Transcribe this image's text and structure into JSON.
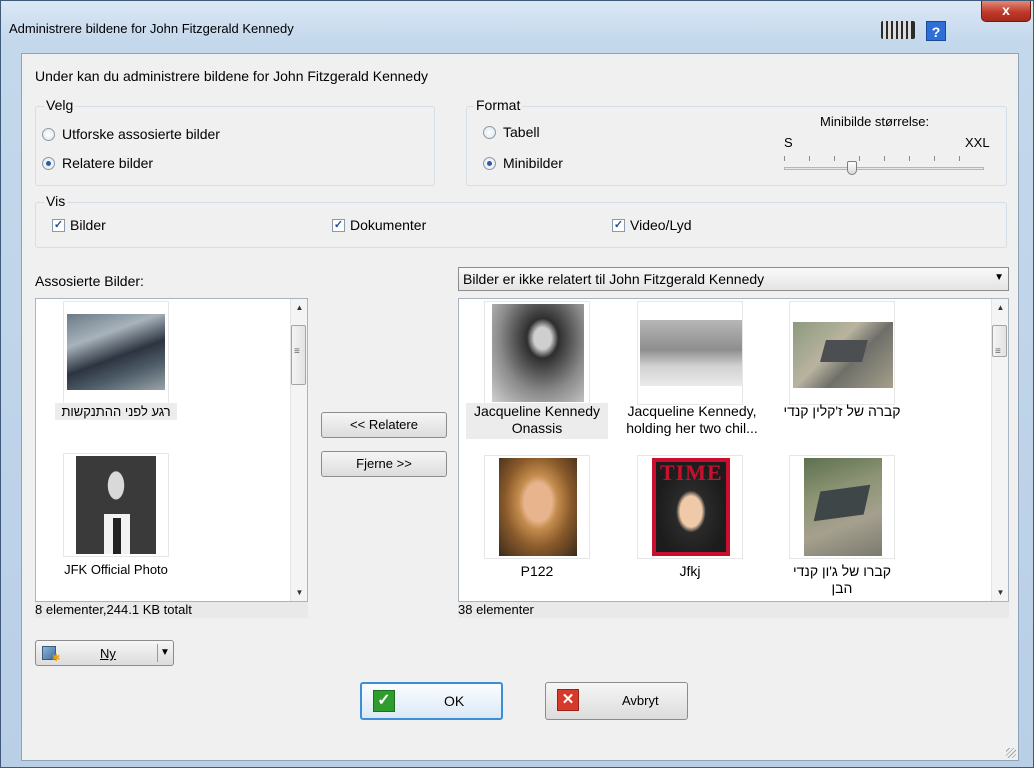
{
  "window": {
    "title": "Administrere bildene for John Fitzgerald Kennedy",
    "help_label": "?",
    "close_label": "x"
  },
  "intro": "Under kan du administrere bildene for John Fitzgerald Kennedy",
  "velg": {
    "title": "Velg",
    "options": [
      {
        "label": "Utforske assosierte bilder",
        "selected": false
      },
      {
        "label": "Relatere bilder",
        "selected": true
      }
    ]
  },
  "format": {
    "title": "Format",
    "options": [
      {
        "label": "Tabell",
        "selected": false
      },
      {
        "label": "Minibilder",
        "selected": true
      }
    ],
    "size_label": "Minibilde størrelse:",
    "size_min": "S",
    "size_max": "XXL",
    "size_value_fraction": 0.33
  },
  "vis": {
    "title": "Vis",
    "checks": [
      {
        "label": "Bilder",
        "checked": true
      },
      {
        "label": "Dokumenter",
        "checked": true
      },
      {
        "label": "Video/Lyd",
        "checked": true
      }
    ]
  },
  "left_panel": {
    "label": "Assosierte Bilder:",
    "items": [
      {
        "caption": "רגע לפני ההתנקשות",
        "image": "motorcade-photo"
      },
      {
        "caption": "JFK Official Photo",
        "image": "portrait-photo"
      }
    ],
    "status": "8 elementer,244.1 KB totalt"
  },
  "middle_buttons": {
    "relate": "<< Relatere",
    "remove": "Fjerne >>"
  },
  "right_panel": {
    "dropdown_value": "Bilder er ikke relatert til John Fitzgerald Kennedy",
    "items": [
      {
        "caption": "Jacqueline Kennedy Onassis",
        "image": "bw-portrait",
        "selected": true
      },
      {
        "caption": "Jacqueline Kennedy, holding her two chil...",
        "image": "steps-photo",
        "selected": false
      },
      {
        "caption": "קברה של ז'קלין קנדי",
        "image": "grave-photo",
        "selected": false
      },
      {
        "caption": "P122",
        "image": "color-portrait",
        "selected": false
      },
      {
        "caption": "Jfkj",
        "image": "magazine-cover",
        "selected": false
      },
      {
        "caption": "קברו של ג'ון קנדי הבן",
        "image": "grave-photo-2",
        "selected": false
      }
    ],
    "status": "38 elementer",
    "magazine_masthead": "TIME"
  },
  "new_button": {
    "label": "Ny"
  },
  "ok_button": {
    "label": "OK"
  },
  "cancel_button": {
    "label": "Avbryt"
  },
  "colors": {
    "title_bar": "#c4d8ec",
    "close": "#c0392b",
    "selection": "#e6e6e6",
    "ok_check": "#2e9d2e",
    "cancel_x": "#d63a2a"
  }
}
